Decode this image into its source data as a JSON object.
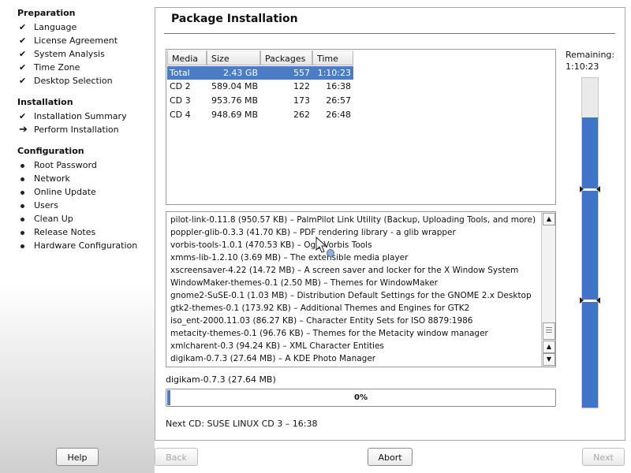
{
  "sidebar": {
    "sections": [
      {
        "heading": "Preparation",
        "items": [
          {
            "label": "Language",
            "state": "done"
          },
          {
            "label": "License Agreement",
            "state": "done"
          },
          {
            "label": "System Analysis",
            "state": "done"
          },
          {
            "label": "Time Zone",
            "state": "done"
          },
          {
            "label": "Desktop Selection",
            "state": "done"
          }
        ]
      },
      {
        "heading": "Installation",
        "items": [
          {
            "label": "Installation Summary",
            "state": "done"
          },
          {
            "label": "Perform Installation",
            "state": "current"
          }
        ]
      },
      {
        "heading": "Configuration",
        "items": [
          {
            "label": "Root Password",
            "state": "pending"
          },
          {
            "label": "Network",
            "state": "pending"
          },
          {
            "label": "Online Update",
            "state": "pending"
          },
          {
            "label": "Users",
            "state": "pending"
          },
          {
            "label": "Clean Up",
            "state": "pending"
          },
          {
            "label": "Release Notes",
            "state": "pending"
          },
          {
            "label": "Hardware Configuration",
            "state": "pending"
          }
        ]
      }
    ]
  },
  "main": {
    "title": "Package Installation",
    "table": {
      "columns": [
        "Media",
        "Size",
        "Packages",
        "Time"
      ],
      "rows": [
        {
          "media": "Total",
          "size": "2.43 GB",
          "packages": "557",
          "time": "1:10:23",
          "selected": true
        },
        {
          "media": "CD 2",
          "size": "589.04 MB",
          "packages": "122",
          "time": "16:38"
        },
        {
          "media": "CD 3",
          "size": "953.76 MB",
          "packages": "173",
          "time": "26:57"
        },
        {
          "media": "CD 4",
          "size": "948.69 MB",
          "packages": "262",
          "time": "26:48"
        }
      ]
    },
    "log": [
      "pilot-link-0.11.8 (950.57 KB) – PalmPilot Link Utility (Backup, Uploading Tools, and more)",
      "poppler-glib-0.3.3 (41.70 KB) – PDF rendering library - a glib wrapper",
      "vorbis-tools-1.0.1 (470.53 KB) – Ogg Vorbis Tools",
      "xmms-lib-1.2.10 (3.69 MB) – The extensible media player",
      "xscreensaver-4.22 (14.72 MB) – A screen saver and locker for the X Window System",
      "WindowMaker-themes-0.1 (2.50 MB) – Themes for WindowMaker",
      "gnome2-SuSE-0.1 (1.03 MB) – Distribution Default Settings for the GNOME 2.x Desktop",
      "gtk2-themes-0.1 (173.92 KB) – Additional Themes and Engines for GTK2",
      "iso_ent-2000.11.03 (86.27 KB) – Character Entity Sets for ISO 8879:1986",
      "metacity-themes-0.1 (96.76 KB) – Themes for the Metacity window manager",
      "xmlcharent-0.3 (94.24 KB) – XML Character Entities",
      "digikam-0.7.3 (27.64 MB) – A KDE Photo Manager"
    ],
    "current_package": "digikam-0.7.3 (27.64 MB)",
    "progress": {
      "percent_label": "0%",
      "fraction": 0.0
    },
    "next_cd": "Next CD: SUSE LINUX CD 3 – 16:38",
    "remaining": {
      "label": "Remaining:",
      "value": "1:10:23",
      "fraction": 0.88
    }
  },
  "buttons": {
    "help": "Help",
    "back": "Back",
    "abort": "Abort",
    "next": "Next"
  },
  "colors": {
    "accent": "#4a7dc4",
    "gauge": "#3f74c9"
  }
}
